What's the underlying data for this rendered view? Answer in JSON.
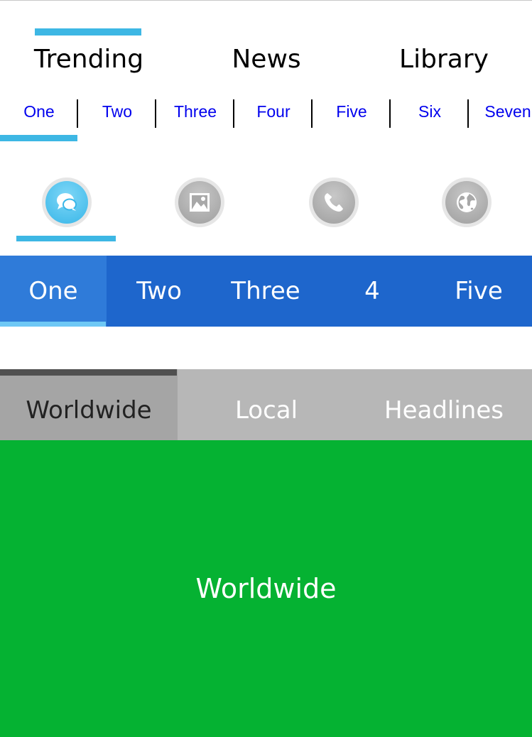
{
  "top_tabs": {
    "items": [
      {
        "label": "Trending",
        "active": true
      },
      {
        "label": "News",
        "active": false
      },
      {
        "label": "Library",
        "active": false
      }
    ]
  },
  "number_tabs": {
    "items": [
      {
        "label": "One",
        "active": true
      },
      {
        "label": "Two",
        "active": false
      },
      {
        "label": "Three",
        "active": false
      },
      {
        "label": "Four",
        "active": false
      },
      {
        "label": "Five",
        "active": false
      },
      {
        "label": "Six",
        "active": false
      },
      {
        "label": "Seven",
        "active": false
      }
    ]
  },
  "icon_tabs": {
    "items": [
      {
        "icon": "chat-bubbles-icon",
        "active": true
      },
      {
        "icon": "image-icon",
        "active": false
      },
      {
        "icon": "phone-icon",
        "active": false
      },
      {
        "icon": "globe-icon",
        "active": false
      }
    ]
  },
  "blue_tabs": {
    "items": [
      {
        "label": "One",
        "active": true
      },
      {
        "label": "Two",
        "active": false
      },
      {
        "label": "Three",
        "active": false
      },
      {
        "label": "4",
        "active": false
      },
      {
        "label": "Five",
        "active": false
      }
    ]
  },
  "gray_tabs": {
    "items": [
      {
        "label": "Worldwide",
        "active": true
      },
      {
        "label": "Local",
        "active": false
      },
      {
        "label": "Headlines",
        "active": false
      }
    ]
  },
  "content": {
    "label": "Worldwide"
  },
  "colors": {
    "indicator": "#3db7e4",
    "blue_bar": "#1e66cc",
    "gray_bar": "#b7b7b7",
    "panel": "#05b232",
    "link_text": "#0000ee"
  }
}
